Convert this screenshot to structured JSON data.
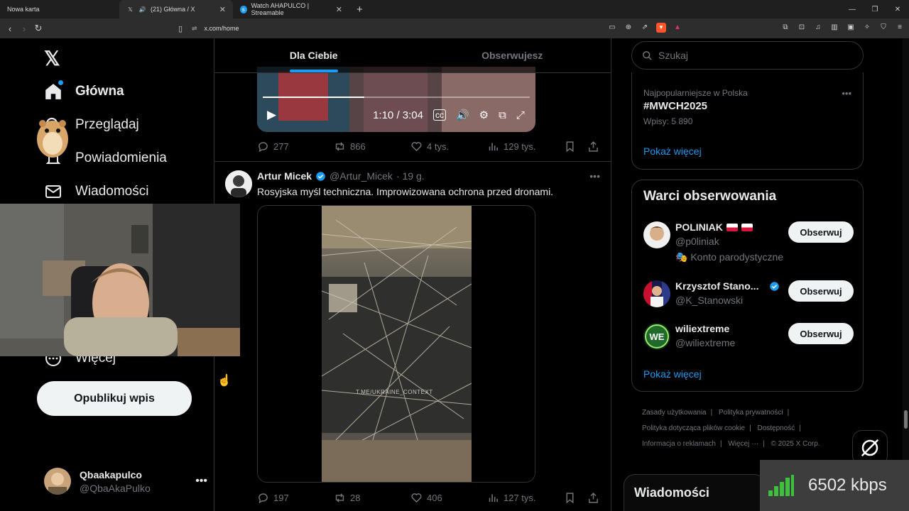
{
  "browser": {
    "tabs": [
      {
        "title": "Nowa karta"
      },
      {
        "title": "(21) Główna / X"
      },
      {
        "title": "Watch AHAPULCO | Streamable"
      }
    ],
    "url": "x.com/home"
  },
  "sidebar": {
    "nav": [
      {
        "label": "Główna"
      },
      {
        "label": "Przeglądaj"
      },
      {
        "label": "Powiadomienia"
      },
      {
        "label": "Wiadomości"
      },
      {
        "label": "Więcej"
      }
    ],
    "publish_label": "Opublikuj wpis",
    "account": {
      "name": "Qbaakapulco",
      "handle": "@QbaAkaPulko"
    }
  },
  "feed": {
    "tabs": [
      {
        "label": "Dla Ciebie"
      },
      {
        "label": "Obserwujesz"
      }
    ],
    "post1": {
      "video_time": "1:10 / 3:04",
      "video_progress": 0.38,
      "replies": "277",
      "reposts": "866",
      "likes": "4 tys.",
      "views": "129 tys."
    },
    "post2": {
      "name": "Artur Micek",
      "handle": "@Artur_Micek",
      "time": "· 19 g.",
      "text": "Rosyjska myśl techniczna. Improwizowana ochrona przed dronami.",
      "watermark": "T.ME/UKRAINE_CONTEXT",
      "replies": "197",
      "reposts": "28",
      "likes": "406",
      "views": "127 tys."
    }
  },
  "right": {
    "search_placeholder": "Szukaj",
    "trend": {
      "meta": "Najpopularniejsze w Polska",
      "tag": "#MWCH2025",
      "count": "Wpisy: 5 890",
      "show_more": "Pokaż więcej"
    },
    "follow": {
      "title": "Warci obserwowania",
      "items": [
        {
          "name": "POLINIAK",
          "handle": "@p0liniak",
          "extra": "Konto parodystyczne",
          "button": "Obserwuj"
        },
        {
          "name": "Krzysztof Stano...",
          "handle": "@K_Stanowski",
          "button": "Obserwuj"
        },
        {
          "name": "wiliextreme",
          "handle": "@wiliextreme",
          "button": "Obserwuj"
        }
      ],
      "show_more": "Pokaż więcej"
    },
    "footer": {
      "links": [
        "Zasady użytkowania",
        "Polityka prywatności",
        "Polityka dotycząca plików cookie",
        "Dostępność",
        "Informacja o reklamach",
        "Więcej ···"
      ],
      "copyright": "© 2025 X Corp."
    },
    "messages_label": "Wiadomości"
  },
  "overlay": {
    "bitrate": "6502 kbps"
  },
  "colors": {
    "accent": "#1d9bf0",
    "bg": "#000000",
    "border": "#2f3336",
    "muted": "#71767b"
  }
}
